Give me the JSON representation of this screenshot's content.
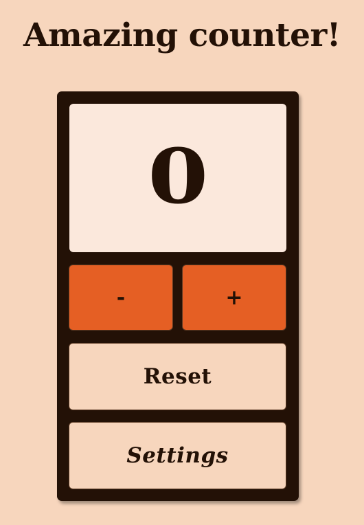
{
  "title": "Amazing counter!",
  "counter": {
    "value": "0"
  },
  "buttons": {
    "decrement_label": "-",
    "increment_label": "+",
    "reset_label": "Reset",
    "settings_label": "Settings"
  },
  "colors": {
    "background": "#f7d6bd",
    "panel": "#231106",
    "display": "#fbe8dc",
    "accent": "#e55f24",
    "text": "#231106"
  }
}
